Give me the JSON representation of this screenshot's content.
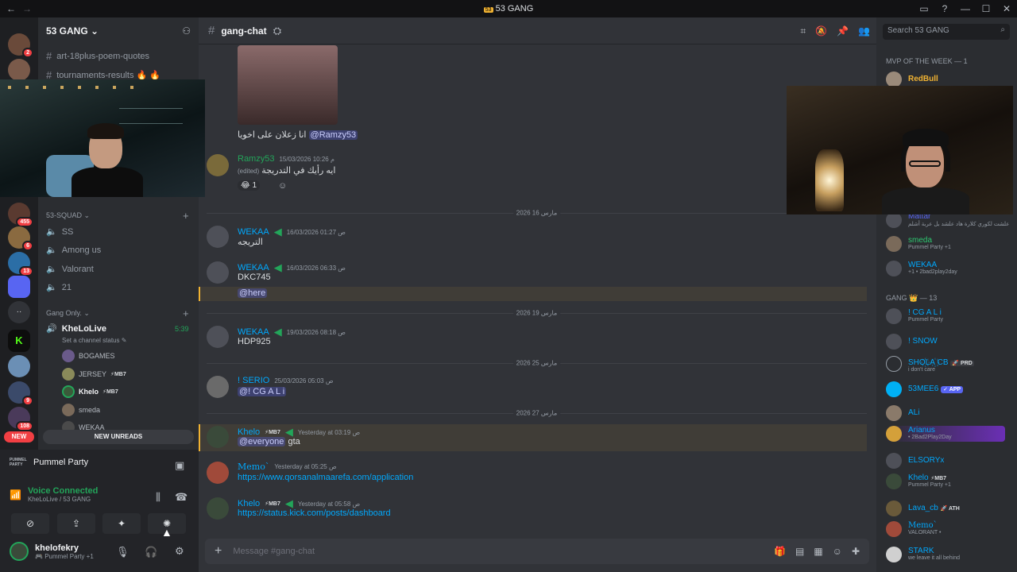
{
  "window": {
    "title": "53 GANG",
    "back_icon": "arrow-left-icon",
    "forward_icon": "arrow-right-icon"
  },
  "server_badges": [
    "2",
    "455",
    "6",
    "13",
    "9",
    "108"
  ],
  "new_label": "NEW",
  "guild": {
    "name": "53 GANG"
  },
  "channels": {
    "text": [
      "art-18plus-poem-quotes",
      "tournaments-results 🔥 🔥"
    ],
    "squad_category": "53-SQUAD",
    "squad_voice": [
      "SS",
      "Among us",
      "Valorant",
      "21"
    ],
    "gang_category": "Gang Only.",
    "live_channel": {
      "name": "KheLoLive",
      "time": "5:39",
      "status": "Set a channel status"
    },
    "voice_users": [
      {
        "name": "BOGAMES",
        "tag": ""
      },
      {
        "name": "JERSEY",
        "tag": "MB7"
      },
      {
        "name": "Khelo",
        "tag": "MB7"
      },
      {
        "name": "smeda",
        "tag": ""
      },
      {
        "name": "WEKAA",
        "tag": ""
      }
    ]
  },
  "new_unreads": "NEW UNREADS",
  "activity": {
    "game_logo": "PUMMEL PARTY",
    "name": "Pummel Party"
  },
  "voice": {
    "title": "Voice Connected",
    "sub": "KheLoLive / 53 GANG"
  },
  "user": {
    "name": "khelofekry",
    "status": "Pummel Party +1"
  },
  "chat": {
    "channel": "gang-chat",
    "messages": [
      {
        "text": "انا زعلان على اخويا",
        "mention": "@Ramzy53"
      },
      {
        "author": "Ramzy53",
        "time": "15/03/2026 10:26 م",
        "edited": "(edited)",
        "text": "ايه رأيك في التدريجة",
        "reaction": "😂 1"
      },
      {
        "author": "WEKAA",
        "time": "16/03/2026 01:27 ص",
        "text": "التريجه"
      },
      {
        "author": "WEKAA",
        "time": "16/03/2026 06:33 ص",
        "text": "DKC745",
        "mention": "@here"
      },
      {
        "author": "WEKAA",
        "time": "19/03/2026 08:18 ص",
        "text": "HDP925"
      },
      {
        "author": "! SERIO",
        "time": "25/03/2026 05:03 ص",
        "text": "@!        CG A L i"
      },
      {
        "author": "Khelo",
        "tag": "MB7",
        "time": "Yesterday at 03:19 ص",
        "mention": "@everyone",
        "text": "gta"
      },
      {
        "author": "Memo`",
        "time": "Yesterday at 05:25 ص",
        "link": "https://www.qorsanalmaarefa.com/application"
      },
      {
        "author": "Khelo",
        "tag": "MB7",
        "time": "Yesterday at 05:58 ص",
        "link": "https://status.kick.com/posts/dashboard"
      }
    ],
    "dividers": [
      "مارس 16 2026",
      "مارس 19 2026",
      "مارس 25 2026",
      "مارس 27 2026"
    ],
    "composer_placeholder": "Message #gang-chat"
  },
  "members": {
    "search_placeholder": "Search 53 GANG",
    "mvp_category": "MVP OF THE WEEK — 1",
    "mvp": {
      "name": "RedBull"
    },
    "online_top": [
      {
        "name": "Mattar",
        "status": "علشت لكوري كلارة هاد علشد بل عربة أشلم",
        "color": "#5865f2"
      },
      {
        "name": "smeda",
        "status": "Pummel Party +1",
        "color": "#2dc770"
      },
      {
        "name": "WEKAA",
        "status": "+1 • 2bad2play2day",
        "color": "#00a8fc"
      }
    ],
    "gang_category": "GANG 👑 — 13",
    "gang": [
      {
        "name": "! CG A L i",
        "status": "Pummel Party",
        "color": "#00a8fc"
      },
      {
        "name": "! SNOW",
        "status": "",
        "color": "#00a8fc"
      },
      {
        "name": "SHO꙰LA꙰ CB",
        "tag": "PRD",
        "status": "i don't care",
        "color": "#00a8fc"
      },
      {
        "name": "53MEE6",
        "tag": "APP",
        "status": "",
        "color": "#00a8fc"
      },
      {
        "name": "ALi",
        "status": "",
        "color": "#00a8fc"
      },
      {
        "name": "Arianus",
        "status": "• 2Bad2Play2Day",
        "color": "#00a8fc"
      },
      {
        "name": "ELSORYx",
        "status": "",
        "color": "#00a8fc"
      },
      {
        "name": "Khelo",
        "tag": "MB7",
        "status": "Pummel Party +1",
        "color": "#00a8fc"
      },
      {
        "name": "Lava_cb",
        "tag": "ATH",
        "status": "",
        "color": "#00a8fc"
      },
      {
        "name": "Memo`",
        "status": "VALORANT •",
        "color": "#00a8fc"
      },
      {
        "name": "STARK",
        "status": "we leave it all behind",
        "color": "#00a8fc"
      }
    ]
  },
  "colors": {
    "accent": "#5865f2",
    "online": "#23a55a",
    "mention_bar": "#f0b232",
    "link": "#00a8fc",
    "wekaa": "#00a8fc",
    "ramzy": "#23a55a"
  }
}
